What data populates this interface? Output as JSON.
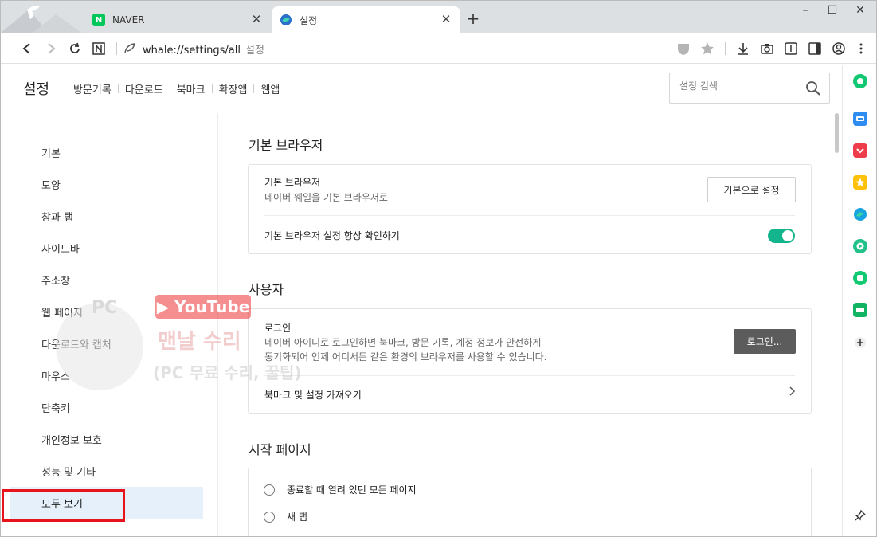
{
  "window": {
    "minimize_icon": "minimize-icon",
    "maximize_icon": "maximize-icon",
    "close_icon": "close-icon"
  },
  "tabs": [
    {
      "label": "NAVER",
      "favicon": "N",
      "active": false
    },
    {
      "label": "설정",
      "favicon": "whale-icon",
      "active": true
    }
  ],
  "toolbar": {
    "url": "whale://settings/all",
    "url_suffix": "설정"
  },
  "header": {
    "title": "설정",
    "links": [
      "방문기록",
      "다운로드",
      "북마크",
      "확장앱",
      "웹앱"
    ],
    "search_placeholder": "설정 검색"
  },
  "nav": {
    "items": [
      "기본",
      "모양",
      "창과 탭",
      "사이드바",
      "주소창",
      "웹 페이지",
      "다운로드와 캡처",
      "마우스",
      "단축키",
      "개인정보 보호",
      "성능 및 기타"
    ],
    "active": "모두 보기"
  },
  "sections": {
    "default_browser": {
      "title": "기본 브라우저",
      "row1_title": "기본 브라우저",
      "row1_sub": "네이버 웨일을 기본 브라우저로",
      "row1_button": "기본으로 설정",
      "row2_title": "기본 브라우저 설정 항상 확인하기",
      "row2_toggle": true
    },
    "user": {
      "title": "사용자",
      "login_title": "로그인",
      "login_sub1": "네이버 아이디로 로그인하면 북마크, 방문 기록, 계정 정보가 안전하게",
      "login_sub2": "동기화되어 언제 어디서든 같은 환경의 브라우저를 사용할 수 있습니다.",
      "login_button": "로그인...",
      "import_label": "북마크 및 설정 가져오기"
    },
    "start_page": {
      "title": "시작 페이지",
      "options": [
        "종료할 때 열려 있던 모든 페이지",
        "새 탭"
      ]
    }
  },
  "watermark": {
    "youtube": "YouTube",
    "pc": "PC",
    "line1": "맨날 수리",
    "line2": "(PC 무료 수리, 꿀팁)"
  },
  "colors": {
    "toggle_on": "#13b58c",
    "active_nav_bg": "#e6f0fb",
    "highlight_box": "#e8141b",
    "login_button_bg": "#5c5c5c"
  }
}
